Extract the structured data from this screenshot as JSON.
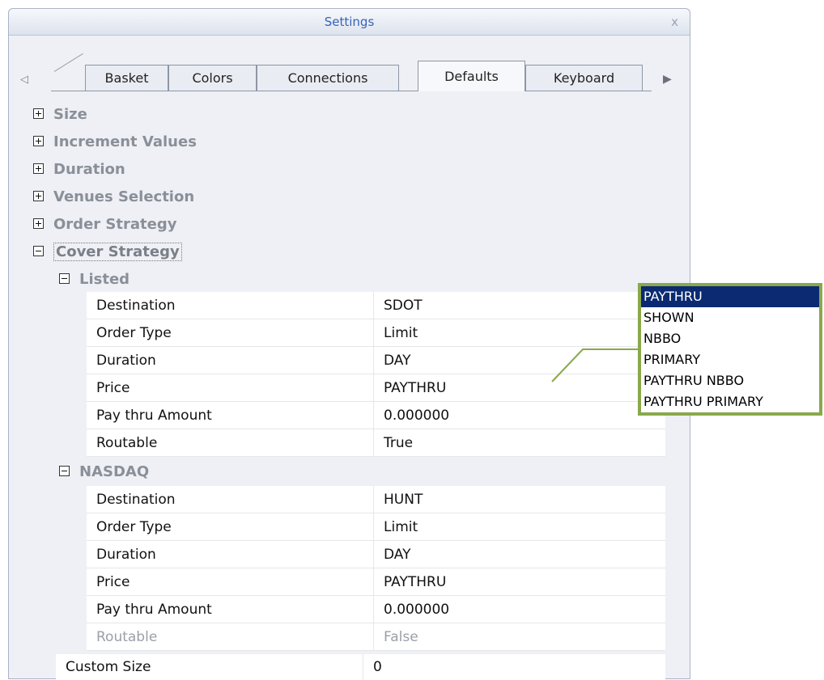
{
  "window": {
    "title": "Settings",
    "close_glyph": "x"
  },
  "tabs": [
    {
      "label": "Basket"
    },
    {
      "label": "Colors"
    },
    {
      "label": "Connections"
    },
    {
      "label": "Defaults",
      "active": true
    },
    {
      "label": "Keyboard"
    }
  ],
  "categories": {
    "size": "Size",
    "increment_values": "Increment Values",
    "duration": "Duration",
    "venues_selection": "Venues Selection",
    "order_strategy": "Order Strategy",
    "cover_strategy": "Cover Strategy"
  },
  "listed": {
    "label": "Listed",
    "rows": [
      {
        "name": "Destination",
        "value": "SDOT"
      },
      {
        "name": "Order Type",
        "value": "Limit"
      },
      {
        "name": "Duration",
        "value": "DAY"
      },
      {
        "name": "Price",
        "value": "PAYTHRU"
      },
      {
        "name": "Pay thru Amount",
        "value": "0.000000"
      },
      {
        "name": "Routable",
        "value": "True"
      }
    ]
  },
  "nasdaq": {
    "label": "NASDAQ",
    "rows": [
      {
        "name": "Destination",
        "value": "HUNT"
      },
      {
        "name": "Order Type",
        "value": "Limit"
      },
      {
        "name": "Duration",
        "value": "DAY"
      },
      {
        "name": "Price",
        "value": "PAYTHRU"
      },
      {
        "name": "Pay thru Amount",
        "value": "0.000000"
      },
      {
        "name": "Routable",
        "value": "False",
        "disabled": true
      }
    ]
  },
  "custom_size": {
    "name": "Custom Size",
    "value": "0"
  },
  "price_dropdown": {
    "options": [
      "PAYTHRU",
      "SHOWN",
      "NBBO",
      "PRIMARY",
      "PAYTHRU NBBO",
      "PAYTHRU PRIMARY"
    ],
    "selected": "PAYTHRU"
  },
  "colors": {
    "accent": "#3563b8",
    "callout": "#8aa84a",
    "selection": "#0b2a72"
  }
}
